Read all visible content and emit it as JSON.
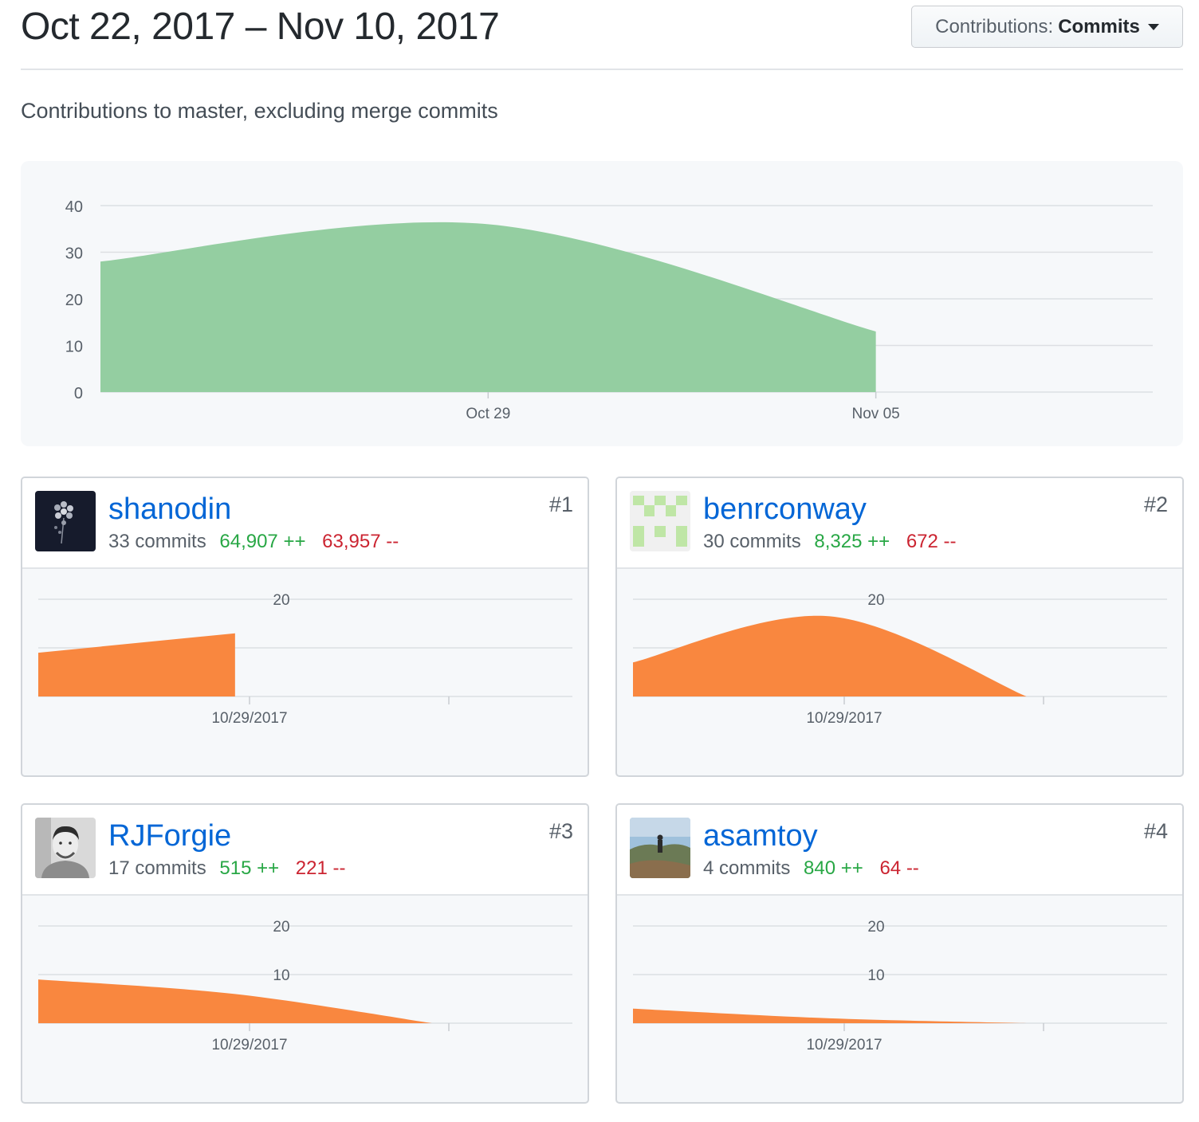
{
  "header": {
    "title": "Oct 22, 2017 – Nov 10, 2017",
    "dropdown_label": "Contributions:",
    "dropdown_value": "Commits"
  },
  "subtitle": "Contributions to master, excluding merge commits",
  "colors": {
    "main_area": "#94cea1",
    "contributor_area": "#f9873f",
    "additions": "#28a745",
    "deletions": "#cb2431",
    "link": "#0366d6"
  },
  "chart_data": [
    {
      "type": "area",
      "title": "",
      "x": [
        "2017-10-22",
        "2017-10-29",
        "2017-11-05"
      ],
      "series": [
        {
          "values": [
            28,
            36,
            13
          ]
        }
      ],
      "x_tick_labels": [
        "Oct 29",
        "Nov 05"
      ],
      "y_ticks": [
        "0",
        "10",
        "20",
        "30",
        "40"
      ],
      "ylim": [
        0,
        40
      ],
      "grid": true
    },
    {
      "type": "area",
      "title": "shanodin",
      "x": [
        "2017-10-22",
        "2017-10-29"
      ],
      "series": [
        {
          "values": [
            9,
            13
          ]
        }
      ],
      "x_tick_labels": [
        "10/29/2017"
      ],
      "y_ticks": [
        "20"
      ],
      "ylim": [
        0,
        20
      ],
      "grid": true
    },
    {
      "type": "area",
      "title": "benrconway",
      "x": [
        "2017-10-22",
        "2017-10-29",
        "2017-11-05"
      ],
      "series": [
        {
          "values": [
            7,
            16.5,
            0
          ]
        }
      ],
      "x_tick_labels": [
        "10/29/2017"
      ],
      "y_ticks": [
        "20"
      ],
      "ylim": [
        0,
        20
      ],
      "grid": true
    },
    {
      "type": "area",
      "title": "RJForgie",
      "x": [
        "2017-10-22",
        "2017-10-29",
        "2017-11-05"
      ],
      "series": [
        {
          "values": [
            9,
            6,
            0
          ]
        }
      ],
      "x_tick_labels": [
        "10/29/2017"
      ],
      "y_ticks": [
        "10",
        "20"
      ],
      "ylim": [
        0,
        20
      ],
      "grid": true
    },
    {
      "type": "area",
      "title": "asamtoy",
      "x": [
        "2017-10-22",
        "2017-10-29",
        "2017-11-05"
      ],
      "series": [
        {
          "values": [
            3,
            1,
            0
          ]
        }
      ],
      "x_tick_labels": [
        "10/29/2017"
      ],
      "y_ticks": [
        "10",
        "20"
      ],
      "ylim": [
        0,
        20
      ],
      "grid": true
    }
  ],
  "contributors": [
    {
      "name": "shanodin",
      "commits": "33 commits",
      "additions": "64,907 ++",
      "deletions": "63,957 --",
      "rank": "#1",
      "avatar": "flower-photo-avatar"
    },
    {
      "name": "benrconway",
      "commits": "30 commits",
      "additions": "8,325 ++",
      "deletions": "672 --",
      "rank": "#2",
      "avatar": "identicon-avatar"
    },
    {
      "name": "RJForgie",
      "commits": "17 commits",
      "additions": "515 ++",
      "deletions": "221 --",
      "rank": "#3",
      "avatar": "portrait-photo-avatar"
    },
    {
      "name": "asamtoy",
      "commits": "4 commits",
      "additions": "840 ++",
      "deletions": "64 --",
      "rank": "#4",
      "avatar": "landscape-photo-avatar"
    }
  ]
}
